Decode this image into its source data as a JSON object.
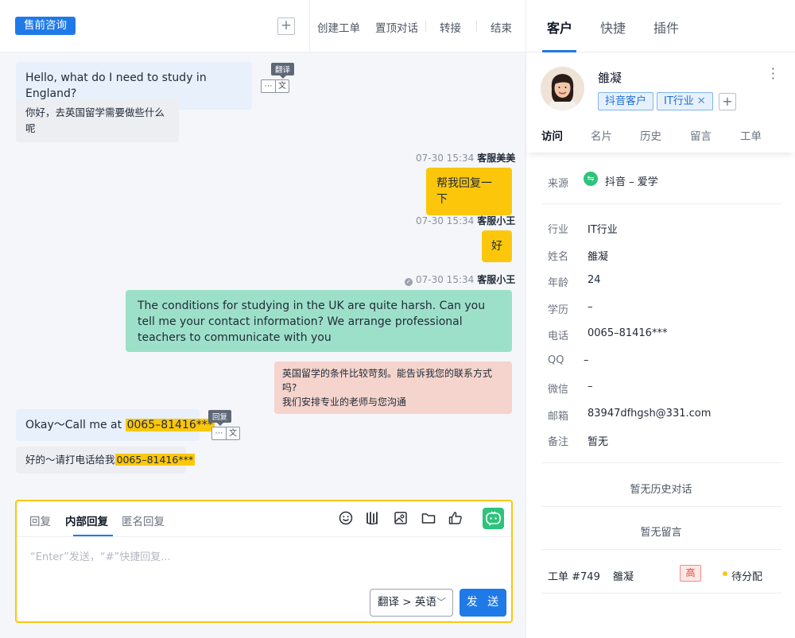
{
  "header": {
    "session_tag": "售前咨询",
    "plus": "+",
    "actions": [
      "创建工单",
      "置顶对话",
      "转接",
      "结束"
    ],
    "right_tabs": [
      "客户",
      "快捷",
      "插件"
    ],
    "active_right_tab": "客户"
  },
  "messages": {
    "m1": {
      "text": "Hello, what do I need to study in England?",
      "tooltip": "翻译"
    },
    "m1_trans": "你好，去英国留学需要做些什么呢",
    "m2_meta": {
      "time": "07-30 15:34",
      "agent": "客服美美"
    },
    "m2": "帮我回复一下",
    "m3_meta": {
      "time": "07-30 15:34",
      "agent": "客服小王"
    },
    "m3": "好",
    "m4_meta": {
      "time": "07-30 15:34",
      "agent": "客服小王"
    },
    "m4": "The conditions for studying in the UK are quite harsh. Can you tell me your contact information? We arrange professional teachers to communicate with you",
    "m4_trans_line1": "英国留学的条件比较苛刻。能告诉我您的联系方式吗?",
    "m4_trans_line2": "我们安排专业的老师与您沟通",
    "m5": {
      "prefix": "Okay～Call me at ",
      "phone": "0065–81416***",
      "tooltip": "回复"
    },
    "m5_trans": {
      "prefix": "好的～请打电话给我",
      "phone": "0065–81416***"
    }
  },
  "composer": {
    "tabs": [
      "回复",
      "内部回复",
      "匿名回复"
    ],
    "active_tab": "内部回复",
    "placeholder": "“Enter”发送，“#”快捷回复...",
    "translate_label": "翻译 > 英语",
    "send_label": "发 送",
    "tools": [
      "emoji-icon",
      "audio-wave-icon",
      "image-icon",
      "folder-icon",
      "thumbs-up-icon",
      "ai-assistant-icon"
    ]
  },
  "customer": {
    "name": "雒凝",
    "tags": [
      "抖音客户",
      "IT行业"
    ],
    "tabs": [
      "访问",
      "名片",
      "历史",
      "留言",
      "工单"
    ],
    "active_tab": "访问",
    "source_label": "来源",
    "source_value": "抖音 – 爱学",
    "fields": [
      {
        "label": "行业",
        "value": "IT行业"
      },
      {
        "label": "姓名",
        "value": "雒凝"
      },
      {
        "label": "年龄",
        "value": "24"
      },
      {
        "label": "学历",
        "value": "–"
      },
      {
        "label": "电话",
        "value": "0065–81416***"
      },
      {
        "label": "QQ",
        "value": "–"
      },
      {
        "label": "微信",
        "value": "–"
      },
      {
        "label": "邮箱",
        "value": "83947dfhgsh@331.com"
      },
      {
        "label": "备注",
        "value": "暂无"
      }
    ],
    "no_history": "暂无历史对话",
    "no_message": "暂无留言",
    "ticket": {
      "id": "工单 #749",
      "name": "雒凝",
      "priority": "高",
      "status": "待分配"
    }
  },
  "colors": {
    "accent": "#1f7ae8",
    "agent_bubble": "#fcc70b",
    "internal_bubble": "#9de0c9",
    "translation_bubble": "#f4d4cc",
    "customer_bubble": "#e7f0fb"
  }
}
